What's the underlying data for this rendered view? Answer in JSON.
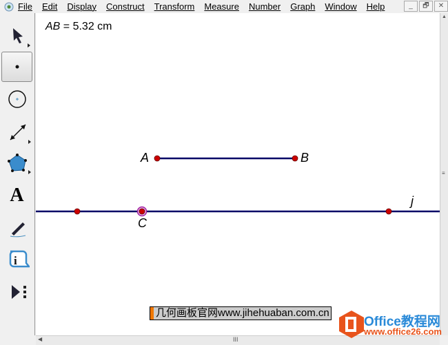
{
  "menubar": {
    "items": [
      "File",
      "Edit",
      "Display",
      "Construct",
      "Transform",
      "Measure",
      "Number",
      "Graph",
      "Window",
      "Help"
    ]
  },
  "window_buttons": [
    "_",
    "🗗",
    "✕"
  ],
  "toolbar": {
    "tools": [
      "arrow-tool",
      "point-tool",
      "compass-tool",
      "straightedge-tool",
      "polygon-tool",
      "text-tool",
      "marker-tool",
      "information-tool",
      "custom-tool"
    ],
    "selected": "point-tool"
  },
  "canvas": {
    "measurement": {
      "name": "AB",
      "equals": " = 5.32 cm"
    },
    "points": {
      "A": "A",
      "B": "B",
      "C": "C",
      "j": "j"
    },
    "caption": "几何画板官网www.jihehuaban.com.cn",
    "line_color": "#000066",
    "point_color": "#cc0000"
  },
  "watermark": {
    "title": "Office教程网",
    "url": "www.office26.com",
    "color": "#e8541c"
  }
}
